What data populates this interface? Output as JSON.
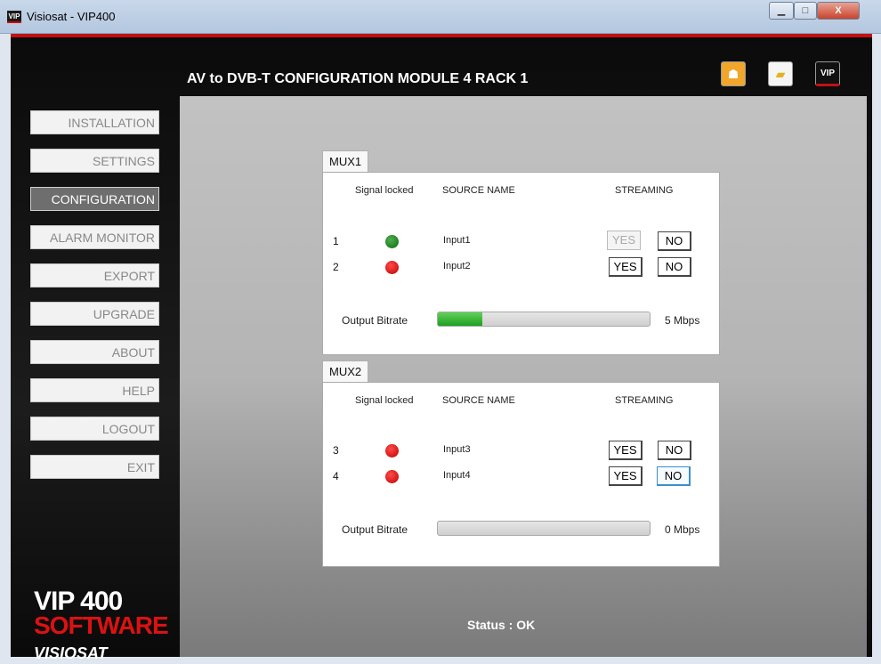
{
  "window": {
    "title": "Visiosat - VIP400",
    "icon_label": "VIP"
  },
  "header": {
    "title": "AV to DVB-T CONFIGURATION MODULE 4 RACK 1"
  },
  "toolbar": {
    "icons": [
      "user-icon",
      "folder-icon",
      "vip-icon"
    ],
    "vip_label": "VIP"
  },
  "nav": [
    {
      "label": "INSTALLATION"
    },
    {
      "label": "SETTINGS"
    },
    {
      "label": "CONFIGURATION",
      "active": true
    },
    {
      "label": "ALARM MONITOR"
    },
    {
      "label": "EXPORT"
    },
    {
      "label": "UPGRADE"
    },
    {
      "label": "ABOUT"
    },
    {
      "label": "HELP"
    },
    {
      "label": "LOGOUT"
    },
    {
      "label": "EXIT"
    }
  ],
  "columns": {
    "signal": "Signal locked",
    "source": "SOURCE NAME",
    "streaming": "STREAMING"
  },
  "mux": [
    {
      "name": "MUX1",
      "rows": [
        {
          "num": "1",
          "signal": "green",
          "source": "Input1",
          "yes": "YES",
          "no": "NO",
          "yes_enabled": false
        },
        {
          "num": "2",
          "signal": "red",
          "source": "Input2",
          "yes": "YES",
          "no": "NO",
          "yes_enabled": true
        }
      ],
      "bitrate_label": "Output Bitrate",
      "bitrate_value": "5 Mbps",
      "bitrate_fraction": 0.21
    },
    {
      "name": "MUX2",
      "rows": [
        {
          "num": "3",
          "signal": "red",
          "source": "Input3",
          "yes": "YES",
          "no": "NO",
          "yes_enabled": true
        },
        {
          "num": "4",
          "signal": "red",
          "source": "Input4",
          "yes": "YES",
          "no": "NO",
          "yes_enabled": true,
          "no_focused": true
        }
      ],
      "bitrate_label": "Output Bitrate",
      "bitrate_value": "0 Mbps",
      "bitrate_fraction": 0
    }
  ],
  "status": "Status : OK",
  "logo": {
    "line1": "VIP 400",
    "line2": "SOFTWARE",
    "line3": "VISIOSAT"
  },
  "colors": {
    "accent": "#c31014",
    "led_green": "#1a8a1a",
    "led_red": "#e00000",
    "bar_fill": "#3cbf3a"
  }
}
